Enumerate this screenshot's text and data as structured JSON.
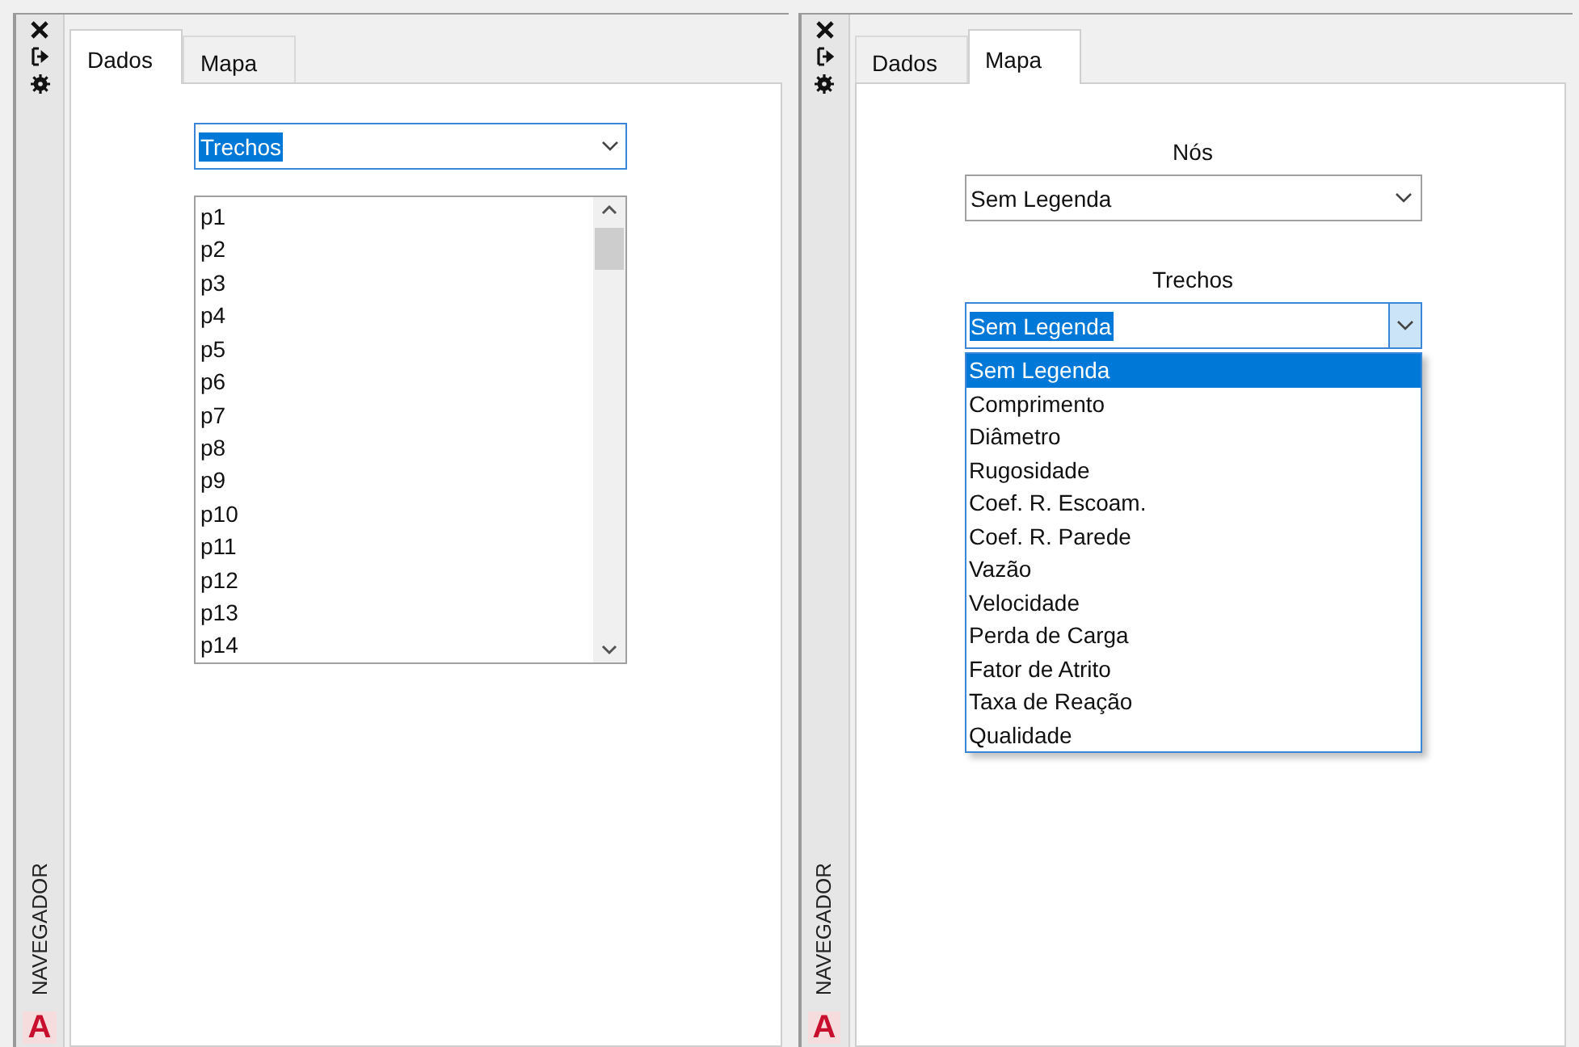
{
  "panels": [
    {
      "kind": "data",
      "side_label": "NAVEGADOR",
      "logo": "A",
      "tabs": [
        {
          "label": "Dados",
          "selected": true
        },
        {
          "label": "Mapa",
          "selected": false
        }
      ],
      "dropdown": {
        "value": "Trechos",
        "highlighted": true
      },
      "list": {
        "items": [
          "p1",
          "p2",
          "p3",
          "p4",
          "p5",
          "p6",
          "p7",
          "p8",
          "p9",
          "p10",
          "p11",
          "p12",
          "p13",
          "p14"
        ]
      }
    },
    {
      "kind": "map",
      "side_label": "NAVEGADOR",
      "logo": "A",
      "tabs": [
        {
          "label": "Dados",
          "selected": false
        },
        {
          "label": "Mapa",
          "selected": true
        }
      ],
      "fields": [
        {
          "label": "Nós",
          "value": "Sem Legenda",
          "highlighted": false,
          "expanded": false
        },
        {
          "label": "Trechos",
          "value": "Sem Legenda",
          "highlighted": true,
          "expanded": true,
          "options": [
            {
              "label": "Sem Legenda",
              "selected": true
            },
            {
              "label": "Comprimento",
              "selected": false
            },
            {
              "label": "Diâmetro",
              "selected": false
            },
            {
              "label": "Rugosidade",
              "selected": false
            },
            {
              "label": "Coef. R. Escoam.",
              "selected": false
            },
            {
              "label": "Coef. R. Parede",
              "selected": false
            },
            {
              "label": "Vazão",
              "selected": false
            },
            {
              "label": "Velocidade",
              "selected": false
            },
            {
              "label": "Perda de Carga",
              "selected": false
            },
            {
              "label": "Fator de Atrito",
              "selected": false
            },
            {
              "label": "Taxa de Reação",
              "selected": false
            },
            {
              "label": "Qualidade",
              "selected": false
            }
          ]
        }
      ]
    }
  ]
}
